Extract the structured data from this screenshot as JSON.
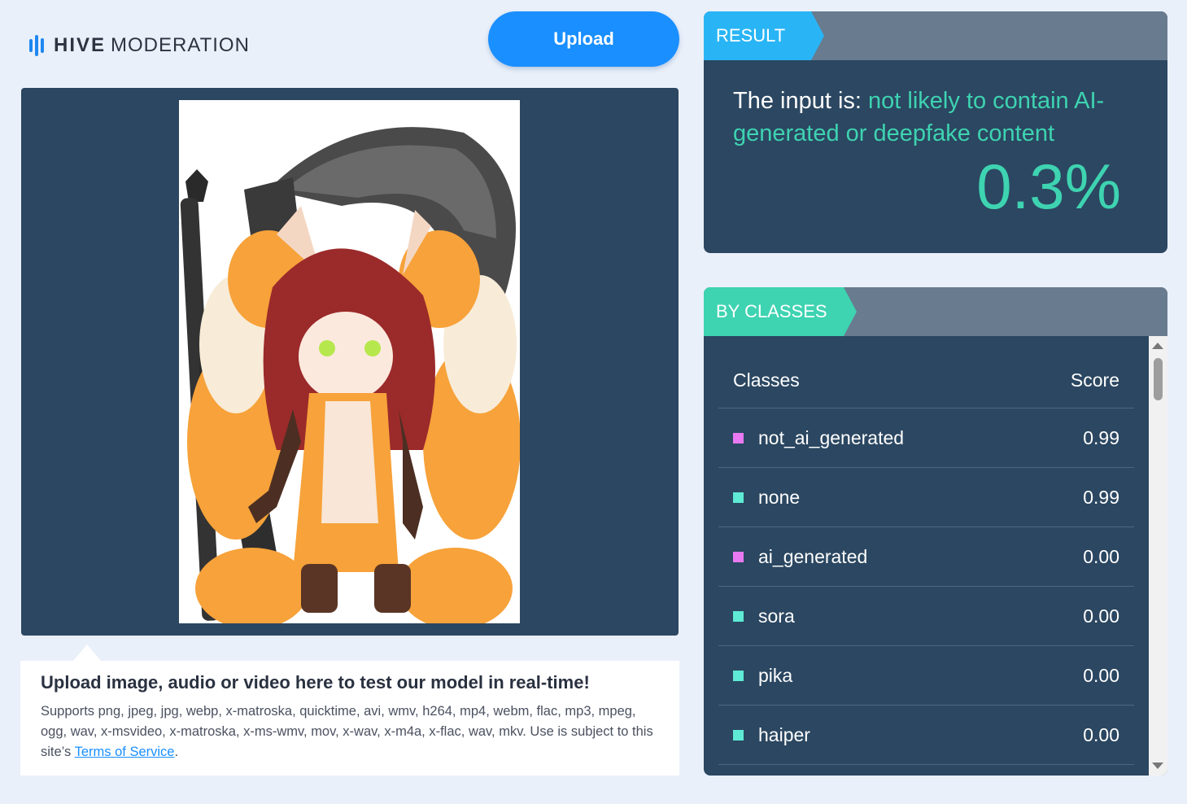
{
  "brand": {
    "name_bold": "HIVE",
    "name_rest": "MODERATION",
    "logo_color": "#1e88f0"
  },
  "upload_button": {
    "label": "Upload"
  },
  "info": {
    "title": "Upload image, audio or video here to test our model in real-time!",
    "desc_before_link": "Supports png, jpeg, jpg, webp, x-matroska, quicktime, avi, wmv, h264, mp4, webm, flac, mp3, mpeg, ogg, wav, x-msvideo, x-matroska, x-ms-wmv, mov, x-wav, x-m4a, x-flac, wav, mkv. Use is subject to this site’s ",
    "link_label": "Terms of Service",
    "desc_after_link": "."
  },
  "result": {
    "tag": "RESULT",
    "prefix": "The input is: ",
    "verdict": "not likely to contain AI-generated or deepfake content",
    "score": "0.3%",
    "highlight_color": "#3ed3b1"
  },
  "classes": {
    "tag": "BY CLASSES",
    "col_class": "Classes",
    "col_score": "Score",
    "rows": [
      {
        "name": "not_ai_generated",
        "score": "0.99",
        "color": "#e879f0"
      },
      {
        "name": "none",
        "score": "0.99",
        "color": "#5eead4"
      },
      {
        "name": "ai_generated",
        "score": "0.00",
        "color": "#e879f0"
      },
      {
        "name": "sora",
        "score": "0.00",
        "color": "#5eead4"
      },
      {
        "name": "pika",
        "score": "0.00",
        "color": "#5eead4"
      },
      {
        "name": "haiper",
        "score": "0.00",
        "color": "#5eead4"
      }
    ]
  },
  "preview": {
    "image_alt": "anime fox girl with giant axe"
  }
}
